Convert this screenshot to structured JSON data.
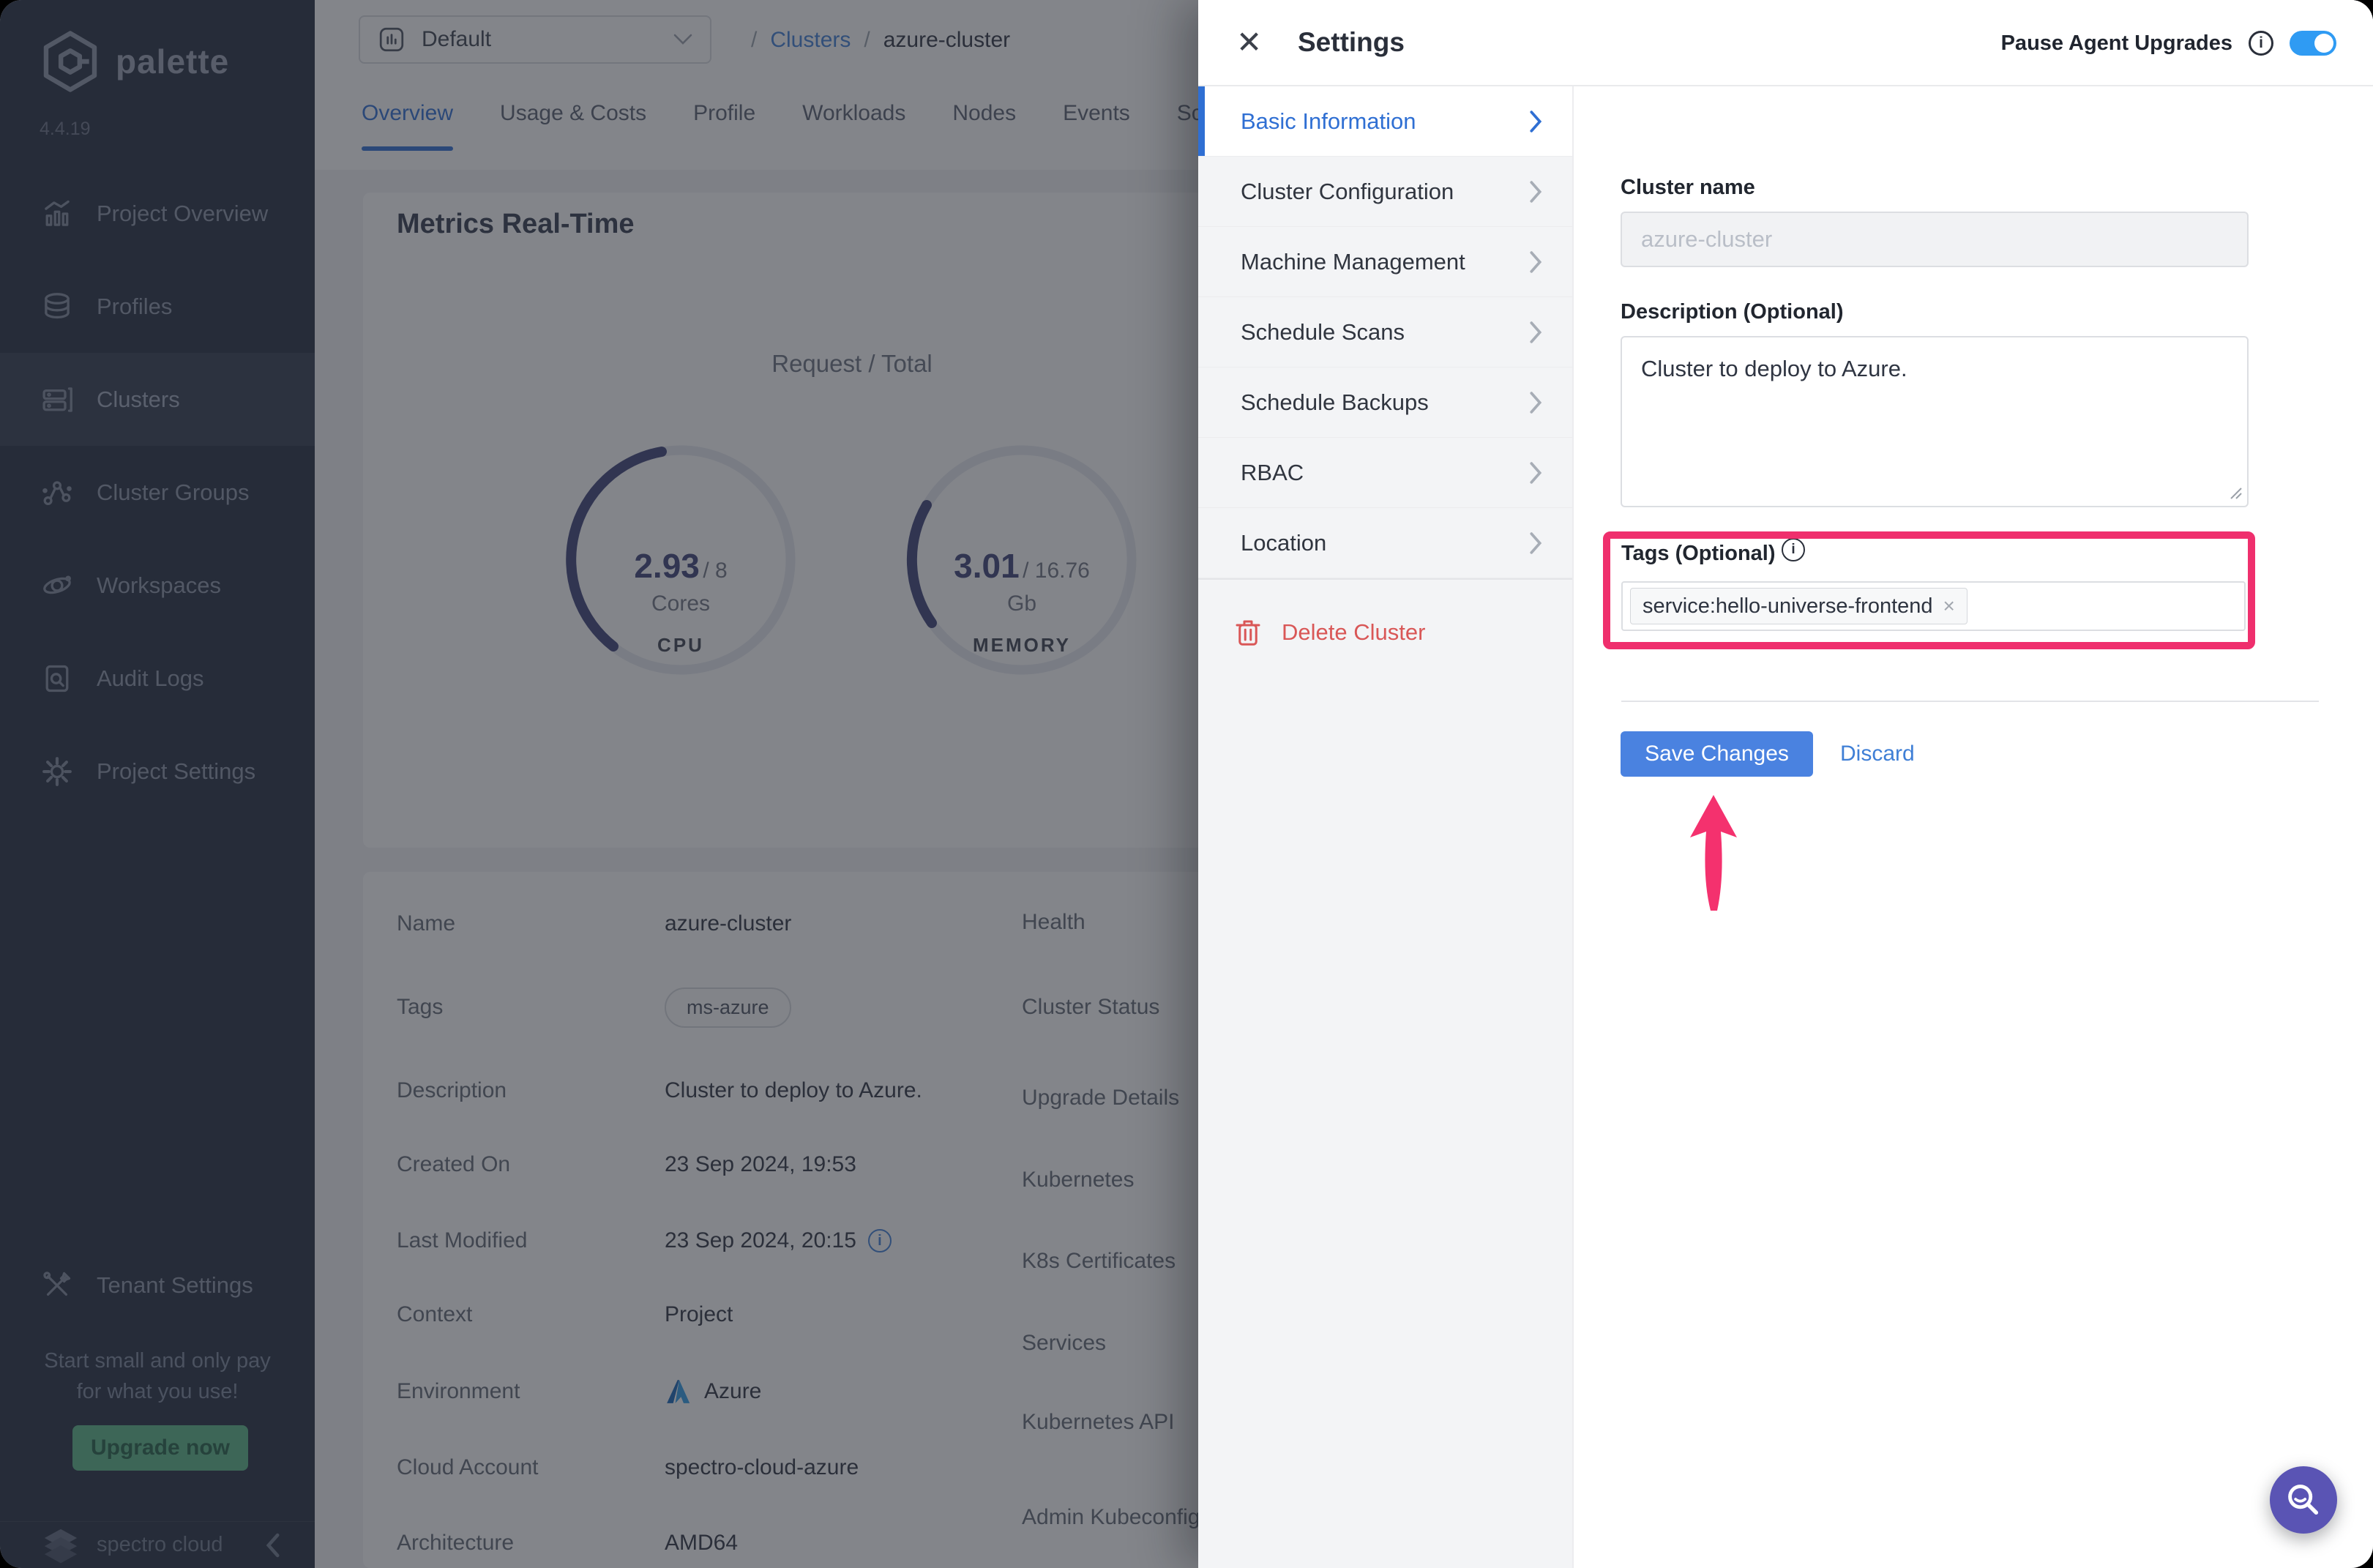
{
  "glyphs": {
    "info": "i",
    "close": "✕",
    "remove": "×"
  },
  "colors": {
    "accent_blue": "#2F6FD3",
    "save_blue": "#4A82E0",
    "link_blue": "#3F7FD6",
    "toggle_blue": "#2F9BF3",
    "highlight_pink": "#EF2F6D",
    "delete_red": "#D95757",
    "fab_purple": "#5A54B4",
    "gauge_indigo": "#3D4178",
    "upgrade_green": "#58B586"
  },
  "sidebar": {
    "logo_text": "palette",
    "version": "4.4.19",
    "items": [
      {
        "icon": "bar-chart",
        "label": "Project Overview"
      },
      {
        "icon": "layers",
        "label": "Profiles"
      },
      {
        "icon": "server",
        "label": "Clusters",
        "active": true
      },
      {
        "icon": "nodes",
        "label": "Cluster Groups"
      },
      {
        "icon": "orbit",
        "label": "Workspaces"
      },
      {
        "icon": "doc-search",
        "label": "Audit Logs"
      },
      {
        "icon": "gear",
        "label": "Project Settings"
      }
    ],
    "tenant_settings": "Tenant Settings",
    "promo_line1": "Start small and only pay",
    "promo_line2": "for what you use!",
    "upgrade_button": "Upgrade now",
    "footer_brand": "spectro cloud"
  },
  "topbar": {
    "project_selector": "Default",
    "breadcrumb": {
      "separator": "/",
      "section": "Clusters",
      "current": "azure-cluster"
    },
    "tabs": [
      {
        "label": "Overview",
        "active": true
      },
      {
        "label": "Usage & Costs"
      },
      {
        "label": "Profile"
      },
      {
        "label": "Workloads"
      },
      {
        "label": "Nodes"
      },
      {
        "label": "Events"
      },
      {
        "label": "Scans"
      }
    ]
  },
  "metrics": {
    "title": "Metrics Real-Time",
    "subtitle": "Request / Total",
    "gauges": [
      {
        "id": "cpu",
        "used": "2.93",
        "total_display": "/ 8",
        "unit": "Cores",
        "label": "CPU",
        "fraction": 0.37
      },
      {
        "id": "memory",
        "used": "3.01",
        "total_display": "/ 16.76",
        "unit": "Gb",
        "label": "MEMORY",
        "fraction": 0.18
      }
    ]
  },
  "details": {
    "left": [
      {
        "label": "Name",
        "value": "azure-cluster"
      },
      {
        "label": "Tags",
        "value": "ms-azure"
      },
      {
        "label": "Description",
        "value": "Cluster to deploy to Azure."
      },
      {
        "label": "Created On",
        "value": "23 Sep 2024, 19:53"
      },
      {
        "label": "Last Modified",
        "value": "23 Sep 2024, 20:15"
      },
      {
        "label": "Context",
        "value": "Project"
      },
      {
        "label": "Environment",
        "value": "Azure"
      },
      {
        "label": "Cloud Account",
        "value": "spectro-cloud-azure"
      },
      {
        "label": "Architecture",
        "value": "AMD64"
      }
    ],
    "right": [
      "Health",
      "Cluster Status",
      "Upgrade Details",
      "Kubernetes",
      "K8s Certificates",
      "Services",
      "Kubernetes API",
      "Admin Kubeconfig F"
    ]
  },
  "settings_panel": {
    "title": "Settings",
    "pause_agent_upgrades": "Pause Agent Upgrades",
    "toggle_on": true,
    "nav": [
      {
        "label": "Basic Information",
        "active": true
      },
      {
        "label": "Cluster Configuration"
      },
      {
        "label": "Machine Management"
      },
      {
        "label": "Schedule Scans"
      },
      {
        "label": "Schedule Backups"
      },
      {
        "label": "RBAC"
      },
      {
        "label": "Location"
      }
    ],
    "delete_cluster": "Delete Cluster",
    "form": {
      "cluster_name_label": "Cluster name",
      "cluster_name_placeholder": "azure-cluster",
      "cluster_name_value": "",
      "description_label": "Description (Optional)",
      "description_value": "Cluster to deploy to Azure.",
      "tags_label": "Tags (Optional)",
      "tag_chip": "service:hello-universe-frontend",
      "save_button": "Save Changes",
      "discard_link": "Discard"
    }
  }
}
